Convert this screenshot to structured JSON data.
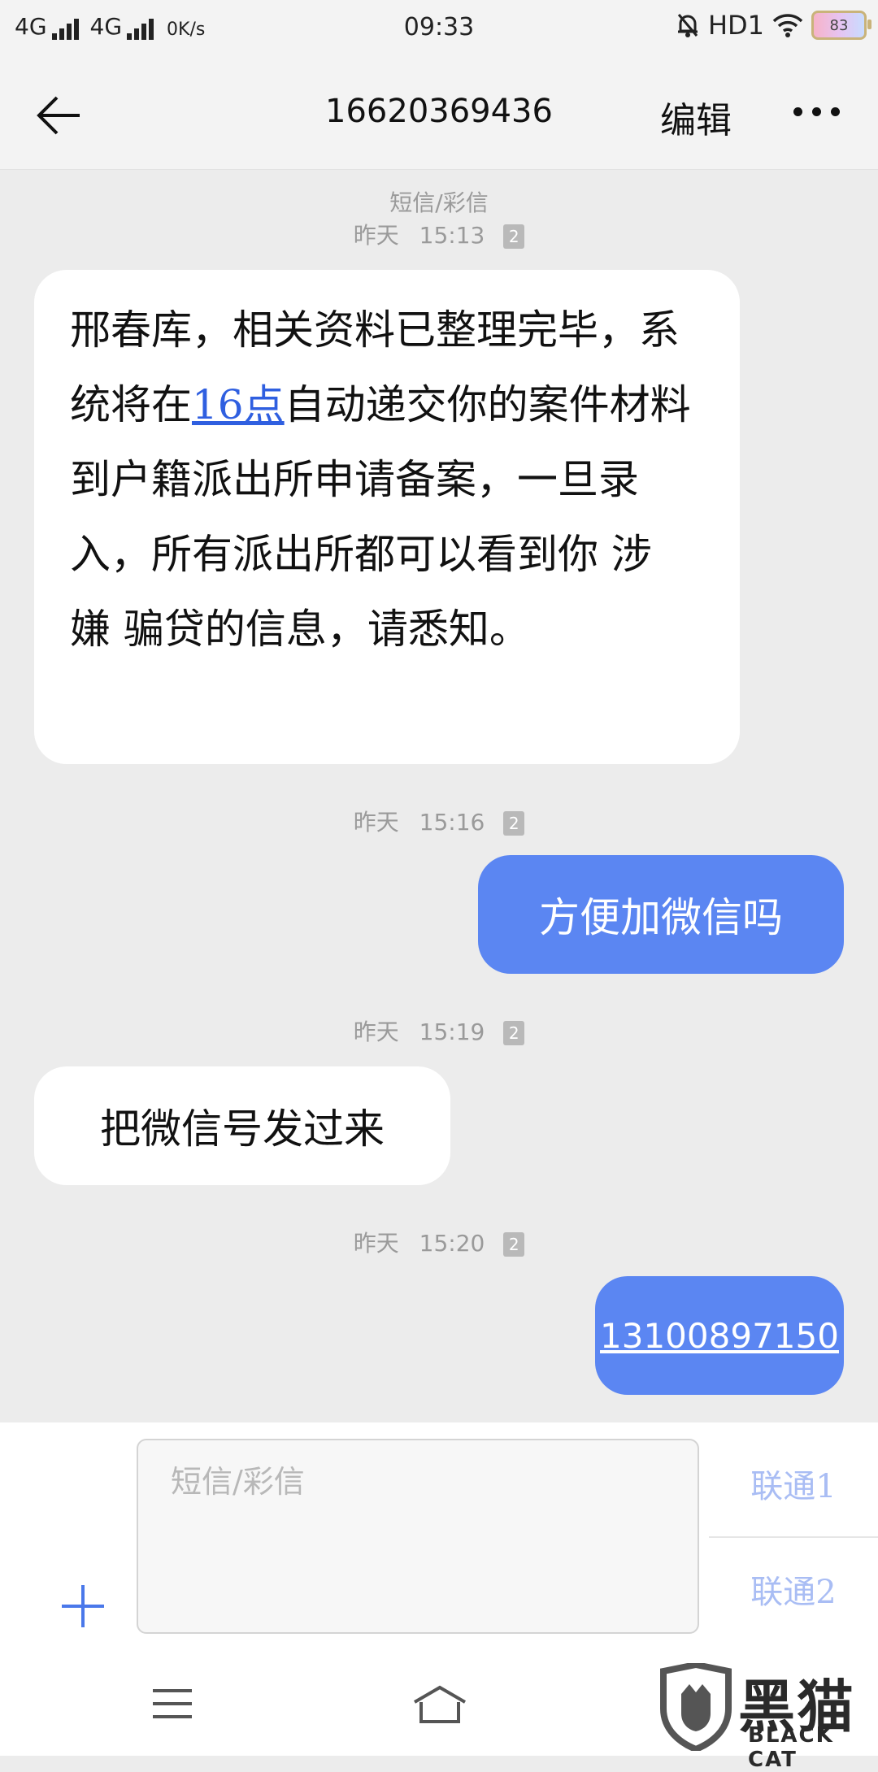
{
  "status_bar": {
    "network1": "4G",
    "network2": "4G",
    "speed": "0K/s",
    "time": "09:33",
    "hd": "HD1",
    "battery": "83"
  },
  "header": {
    "title": "16620369436",
    "edit_label": "编辑"
  },
  "messages": [
    {
      "direction": "incoming",
      "channel": "短信/彩信",
      "day": "昨天",
      "time": "15:13",
      "sim": "2",
      "text_before": "邢春库，相关资料已整理完毕，系统将在",
      "link": "16点",
      "text_after": "自动递交你的案件材料到户籍派出所申请备案，一旦录入，所有派出所都可以看到你 涉 嫌 骗贷的信息，请悉知。"
    },
    {
      "direction": "outgoing",
      "day": "昨天",
      "time": "15:16",
      "sim": "2",
      "text": "方便加微信吗"
    },
    {
      "direction": "incoming",
      "day": "昨天",
      "time": "15:19",
      "sim": "2",
      "text": "把微信号发过来"
    },
    {
      "direction": "outgoing",
      "day": "昨天",
      "time": "15:20",
      "sim": "2",
      "text": "13100897150"
    }
  ],
  "composer": {
    "placeholder": "短信/彩信",
    "sim1_label": "联通1",
    "sim2_label": "联通2"
  },
  "watermark": {
    "cn": "黑猫",
    "en": "BLACK CAT"
  },
  "colors": {
    "outgoing_bubble": "#5b86f2",
    "link": "#2f5fe0",
    "sim_button": "#a9bdf4"
  }
}
